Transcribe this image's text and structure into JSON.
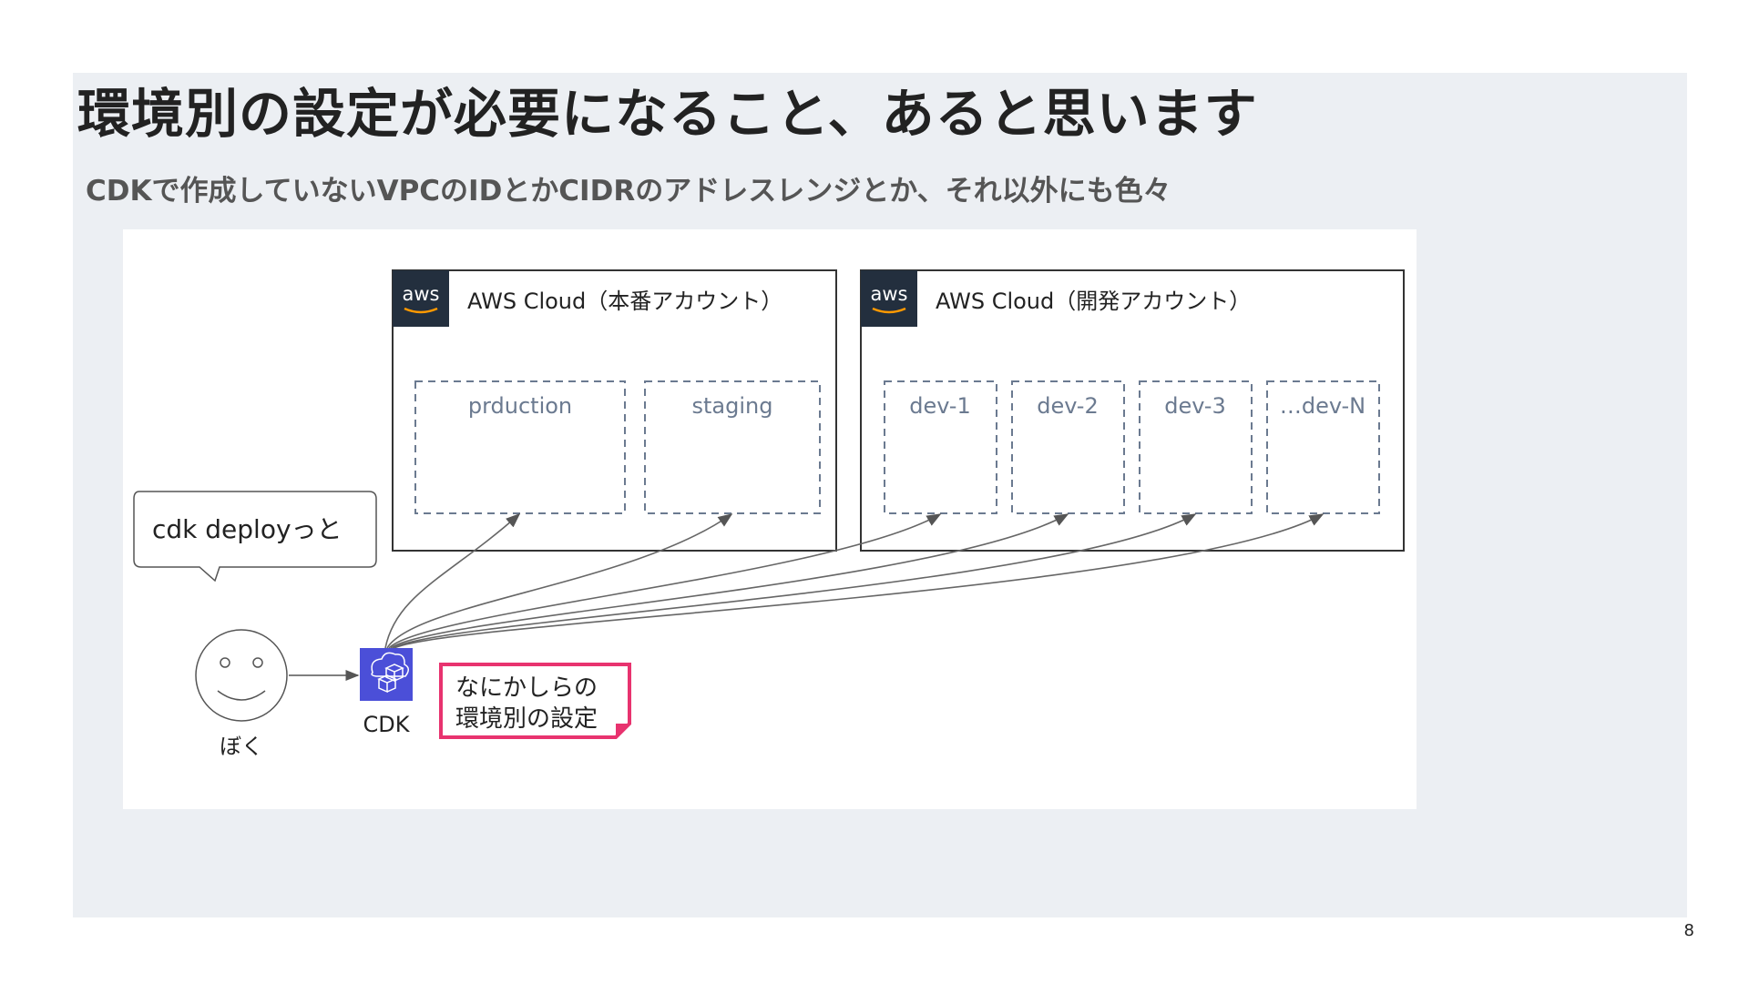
{
  "slide": {
    "title": "環境別の設定が必要になること、あると思います",
    "subtitle": "CDKで作成していないVPCのIDとかCIDRのアドレスレンジとか、それ以外にも色々",
    "page_number": "8"
  },
  "diagram": {
    "prod_account": {
      "logo": "aws",
      "label": "AWS Cloud（本番アカウント）",
      "environments": [
        "prduction",
        "staging"
      ]
    },
    "dev_account": {
      "logo": "aws",
      "label": "AWS Cloud（開発アカウント）",
      "environments": [
        "dev-1",
        "dev-2",
        "dev-3",
        "…dev-N"
      ]
    },
    "speech_bubble": "cdk deployっと",
    "person_label": "ぼく",
    "cdk_label": "CDK",
    "note": {
      "line1": "なにかしらの",
      "line2": "環境別の設定"
    },
    "colors": {
      "aws_logo_bg": "#232f3e",
      "cdk_icon": "#4b4fd8",
      "note_border": "#e8336f",
      "env_box": "#6b7a90"
    }
  }
}
